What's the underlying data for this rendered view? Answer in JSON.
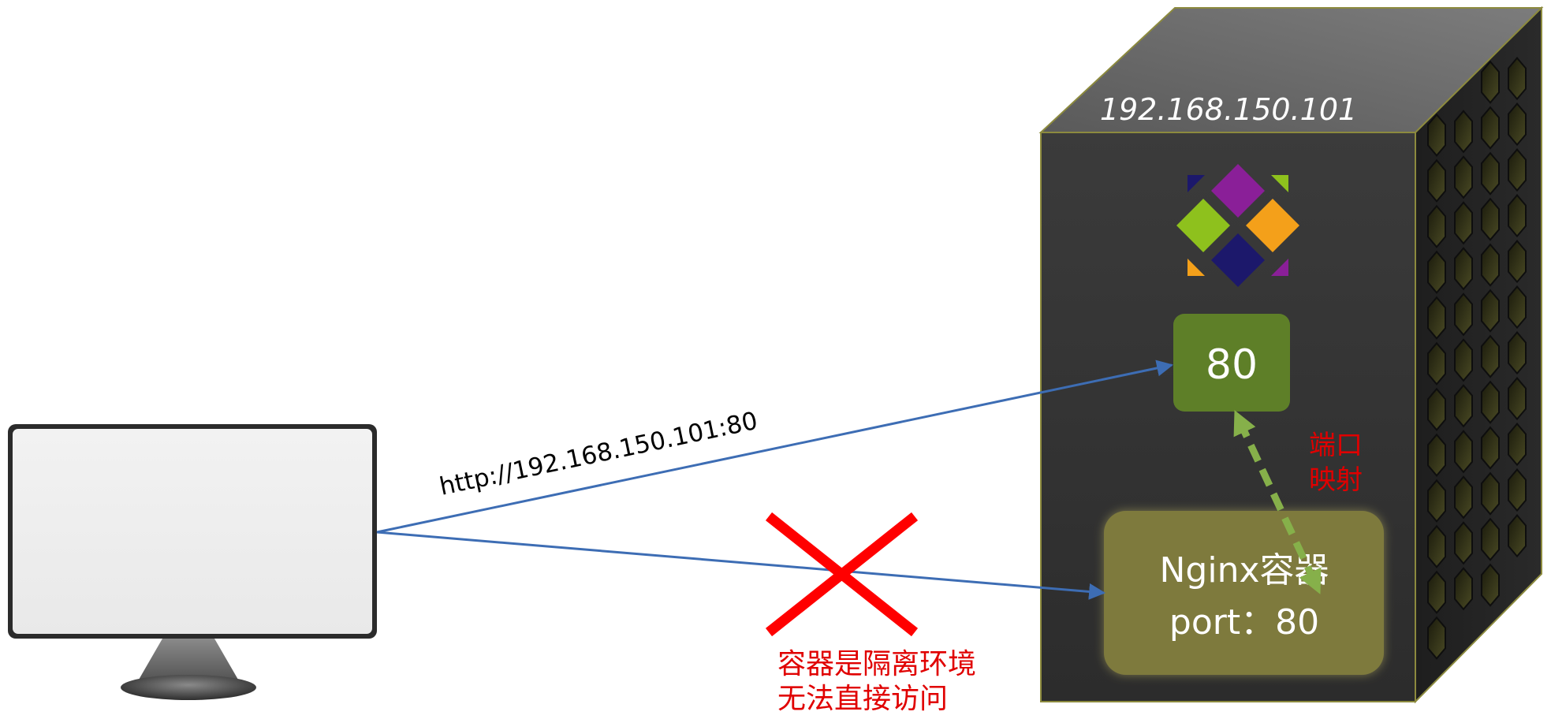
{
  "server": {
    "ip": "192.168.150.101",
    "host_port": "80"
  },
  "container": {
    "name": "Nginx容器",
    "port": "port：80"
  },
  "client": {
    "request_url": "http://192.168.150.101:80"
  },
  "annotations": {
    "port_mapping_line1": "端口",
    "port_mapping_line2": "映射",
    "blocked_line1": "容器是隔离环境",
    "blocked_line2": "无法直接访问"
  },
  "colors": {
    "arrow_blue": "#3d6db4",
    "red": "#e00000",
    "host_port_box": "#5e7f28",
    "container_box": "#7e7a3c",
    "mapping_arrow": "#86b04a",
    "server_front": "#333333",
    "server_side": "#222222",
    "server_top": "#707070",
    "server_edge": "#8c8a3e"
  },
  "icons": {
    "docker_logo": "colorful-diamond-grid-logo",
    "client": "monitor-icon",
    "blocked": "red-x-icon"
  }
}
